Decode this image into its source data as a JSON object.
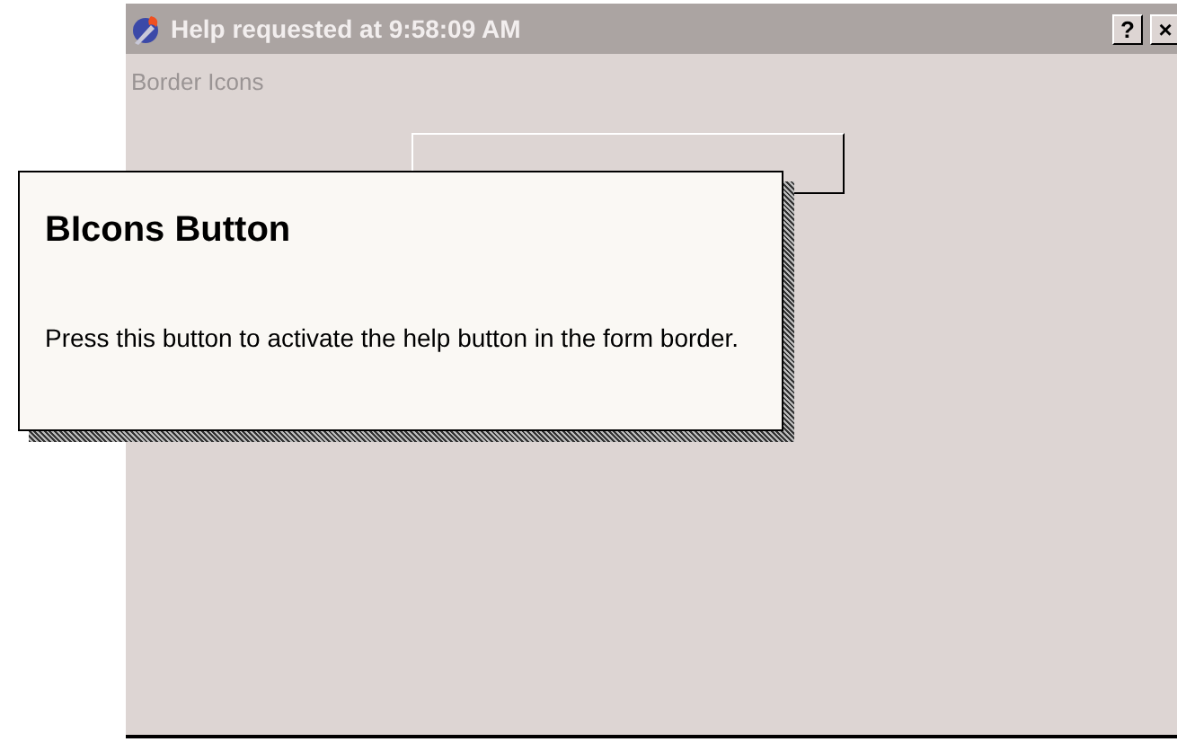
{
  "window": {
    "title": "Help requested at 9:58:09 AM",
    "title_buttons": [
      "?",
      "×"
    ]
  },
  "menu": [
    {
      "label": "Border Icons",
      "disabled": true
    }
  ],
  "button": {
    "kind": "button"
  },
  "help_popup": {
    "title": "BIcons Button",
    "text": "Press this button to activate the help button in the form border."
  }
}
